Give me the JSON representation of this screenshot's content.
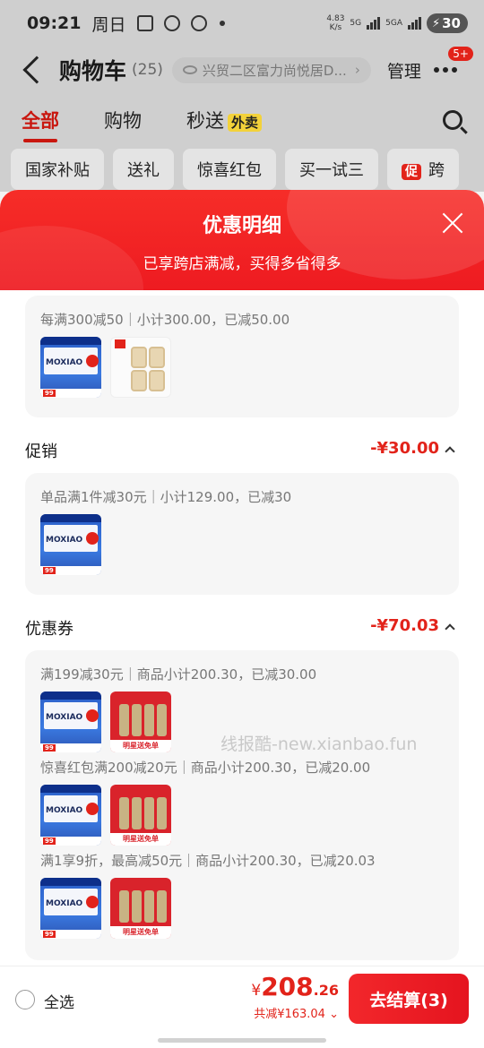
{
  "status": {
    "time": "09:21",
    "day": "周日",
    "speed_top": "4.83",
    "speed_bot": "K/s",
    "net1": "5G",
    "net2": "5GA",
    "battery": "30"
  },
  "header": {
    "title": "购物车",
    "count": "(25)",
    "address": "兴贸二区富力尚悦居D...",
    "manage": "管理",
    "badge": "5+"
  },
  "tabs": [
    {
      "label": "全部"
    },
    {
      "label": "购物"
    },
    {
      "label": "秒送",
      "tag": "外卖"
    }
  ],
  "chips": [
    "国家补贴",
    "送礼",
    "惊喜红包",
    "买一试三",
    "跨"
  ],
  "chip_promo_tag": "促",
  "sheet": {
    "title": "优惠明细",
    "subtitle": "已享跨店满减，买得多省得多",
    "store_discount": {
      "desc": "每满300减50｜小计300.00，已减50.00"
    },
    "promotion": {
      "title": "促销",
      "amount": "-¥30.00",
      "items": [
        {
          "desc": "单品满1件减30元｜小计129.00，已减30"
        }
      ]
    },
    "coupons": {
      "title": "优惠券",
      "amount": "-¥70.03",
      "items": [
        {
          "desc": "满199减30元｜商品小计200.30，已减30.00"
        },
        {
          "desc": "惊喜红包满200减20元｜商品小计200.30，已减20.00"
        },
        {
          "desc": "满1享9折，最高减50元｜商品小计200.30，已减20.03"
        }
      ]
    }
  },
  "product": {
    "moxiao_brand": "MOXIAO",
    "moxiao_price": "99",
    "red_band": "明星送免单"
  },
  "watermark": "线报酷-new.xianbao.fun",
  "bottom": {
    "select_all": "全选",
    "currency": "¥",
    "total_int": "208",
    "total_dec": ".26",
    "saved": "共减¥163.04",
    "checkout": "去结算(3)"
  }
}
